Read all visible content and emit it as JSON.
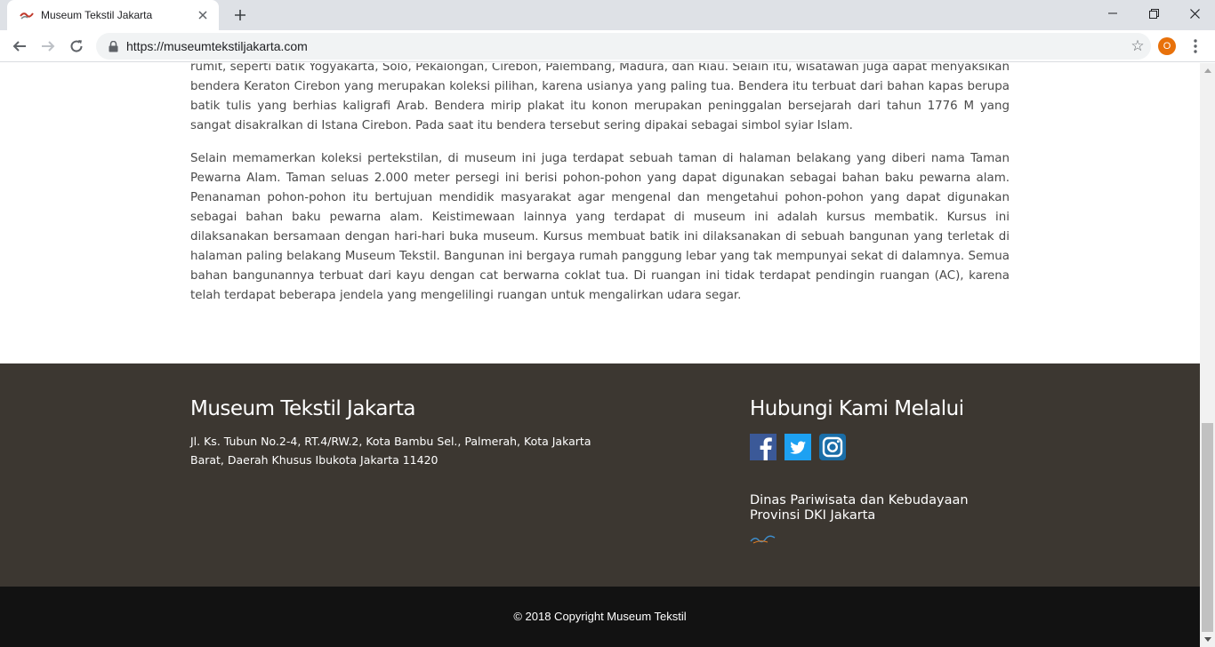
{
  "browser": {
    "tab_title": "Museum Tekstil Jakarta",
    "url": "https://museumtekstiljakarta.com",
    "profile_initial": "O"
  },
  "article": {
    "paragraphs": [
      "rumit, seperti batik Yogyakarta, Solo, Pekalongan, Cirebon, Palembang, Madura, dan Riau. Selain itu, wisatawan juga dapat menyaksikan bendera Keraton Cirebon yang merupakan koleksi pilihan, karena usianya yang paling tua. Bendera itu terbuat dari bahan kapas berupa batik tulis yang berhias kaligrafi Arab. Bendera mirip plakat itu konon merupakan peninggalan bersejarah dari tahun 1776 M yang sangat disakralkan di Istana Cirebon. Pada saat itu bendera tersebut sering dipakai sebagai simbol syiar Islam.",
      "Selain memamerkan koleksi pertekstilan, di museum ini juga terdapat sebuah taman di halaman belakang yang diberi nama Taman Pewarna Alam. Taman seluas 2.000 meter persegi ini berisi pohon-pohon yang dapat digunakan sebagai bahan baku pewarna alam. Penanaman pohon-pohon itu bertujuan mendidik masyarakat agar mengenal dan mengetahui pohon-pohon yang dapat digunakan sebagai bahan baku pewarna alam. Keistimewaan lainnya yang terdapat di museum ini adalah kursus membatik. Kursus ini dilaksanakan bersamaan dengan hari-hari buka museum. Kursus membuat batik ini dilaksanakan di sebuah bangunan yang terletak di halaman paling belakang Museum Tekstil. Bangunan ini bergaya rumah panggung lebar yang tak mempunyai sekat di dalamnya. Semua bahan bangunannya terbuat dari kayu dengan cat berwarna coklat tua. Di ruangan ini tidak terdapat pendingin ruangan (AC), karena telah terdapat beberapa jendela yang mengelilingi ruangan untuk mengalirkan udara segar."
    ]
  },
  "footer": {
    "museum_title": "Museum Tekstil Jakarta",
    "address_line1": "Jl. Ks. Tubun No.2-4, RT.4/RW.2, Kota Bambu Sel., Palmerah, Kota Jakarta",
    "address_line2": "Barat, Daerah Khusus Ibukota Jakarta 11420",
    "contact_title": "Hubungi Kami Melalui",
    "social_icons": [
      "facebook-icon",
      "twitter-icon",
      "instagram-icon"
    ],
    "dinas_line1": "Dinas Pariwisata dan Kebudayaan",
    "dinas_line2": "Provinsi DKI Jakarta",
    "copyright": "© 2018 Copyright Museum Tekstil"
  },
  "colors": {
    "footer_bg": "#3c3731",
    "footer_bottom_bg": "#121212",
    "facebook": "#3b5998",
    "twitter": "#1da1f2",
    "instagram": "#1a6ea8",
    "profile": "#e8710a"
  }
}
